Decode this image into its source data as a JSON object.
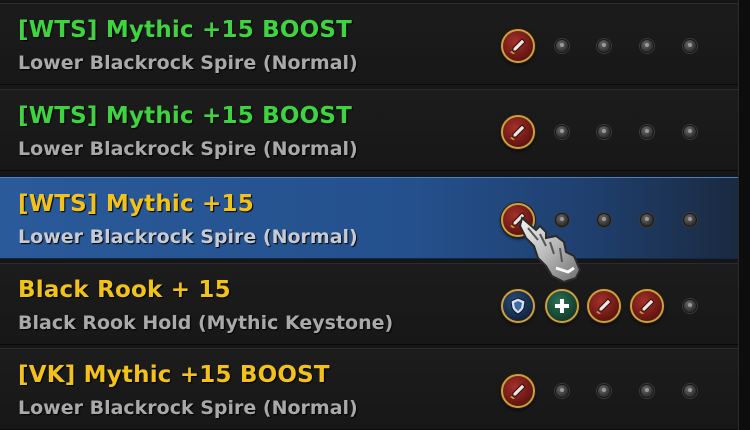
{
  "colors": {
    "wts_green": "#3fd43f",
    "gold": "#f2c21b",
    "subtitle_gray": "#a9a9a9"
  },
  "listings": [
    {
      "title": "[WTS] Mythic +15 BOOST",
      "subtitle": "Lower Blackrock Spire (Normal)",
      "title_color": "#3fd43f",
      "selected": false,
      "slots": [
        "dps-icon",
        "empty-slot-icon",
        "empty-slot-icon",
        "empty-slot-icon",
        "empty-slot-icon"
      ]
    },
    {
      "title": "[WTS] Mythic +15 BOOST",
      "subtitle": "Lower Blackrock Spire (Normal)",
      "title_color": "#3fd43f",
      "selected": false,
      "slots": [
        "dps-icon",
        "empty-slot-icon",
        "empty-slot-icon",
        "empty-slot-icon",
        "empty-slot-icon"
      ]
    },
    {
      "title": "[WTS] Mythic +15",
      "subtitle": "Lower Blackrock Spire (Normal)",
      "title_color": "#f2c21b",
      "selected": true,
      "slots": [
        "dps-icon",
        "empty-slot-icon",
        "empty-slot-icon",
        "empty-slot-icon",
        "empty-slot-icon"
      ]
    },
    {
      "title": "Black Rook + 15",
      "subtitle": "Black Rook Hold (Mythic Keystone)",
      "title_color": "#f2c21b",
      "selected": false,
      "slots": [
        "tank-icon",
        "healer-icon",
        "dps-icon",
        "dps-icon",
        "empty-slot-icon"
      ]
    },
    {
      "title": "[VK] Mythic +15 BOOST",
      "subtitle": "Lower Blackrock Spire (Normal)",
      "title_color": "#f2c21b",
      "selected": false,
      "slots": [
        "dps-icon",
        "empty-slot-icon",
        "empty-slot-icon",
        "empty-slot-icon",
        "empty-slot-icon"
      ]
    }
  ],
  "cursor_icon": "gauntlet-pointer-icon"
}
